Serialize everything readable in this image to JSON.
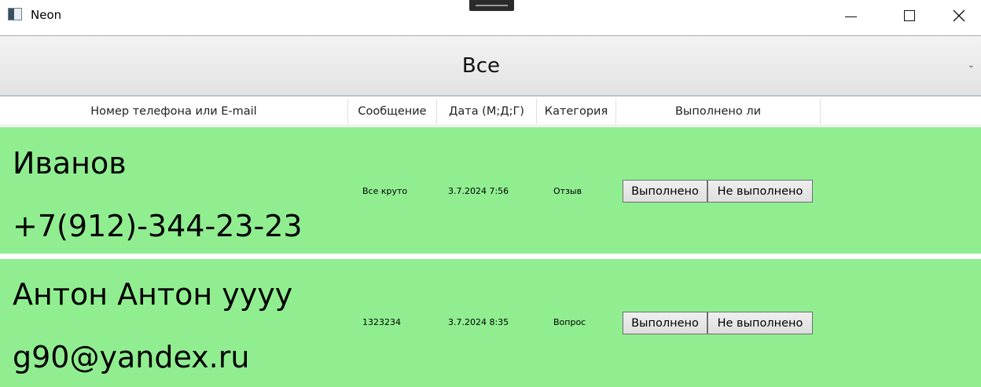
{
  "window": {
    "title": "Neon"
  },
  "filter": {
    "selected": "Все",
    "icon": "chevron-down-icon"
  },
  "columns": [
    "Номер телефона или E-mail",
    "Сообщение",
    "Дата (М;Д;Г)",
    "Категория",
    "Выполнено ли"
  ],
  "rows": [
    {
      "name": "Иванов",
      "contact": "+7(912)-344-23-23",
      "message": "Все круто",
      "date": "3.7.2024 7:56",
      "category": "Отзыв",
      "done_label": "Выполнено",
      "not_done_label": "Не выполнено"
    },
    {
      "name": "Антон Антон уууу",
      "contact": "g90@yandex.ru",
      "message": "1323234",
      "date": "3.7.2024 8:35",
      "category": "Вопрос",
      "done_label": "Выполнено",
      "not_done_label": "Не выполнено"
    }
  ],
  "colors": {
    "row_background": "#90ee90",
    "combo_background": "#e8e8e8"
  }
}
